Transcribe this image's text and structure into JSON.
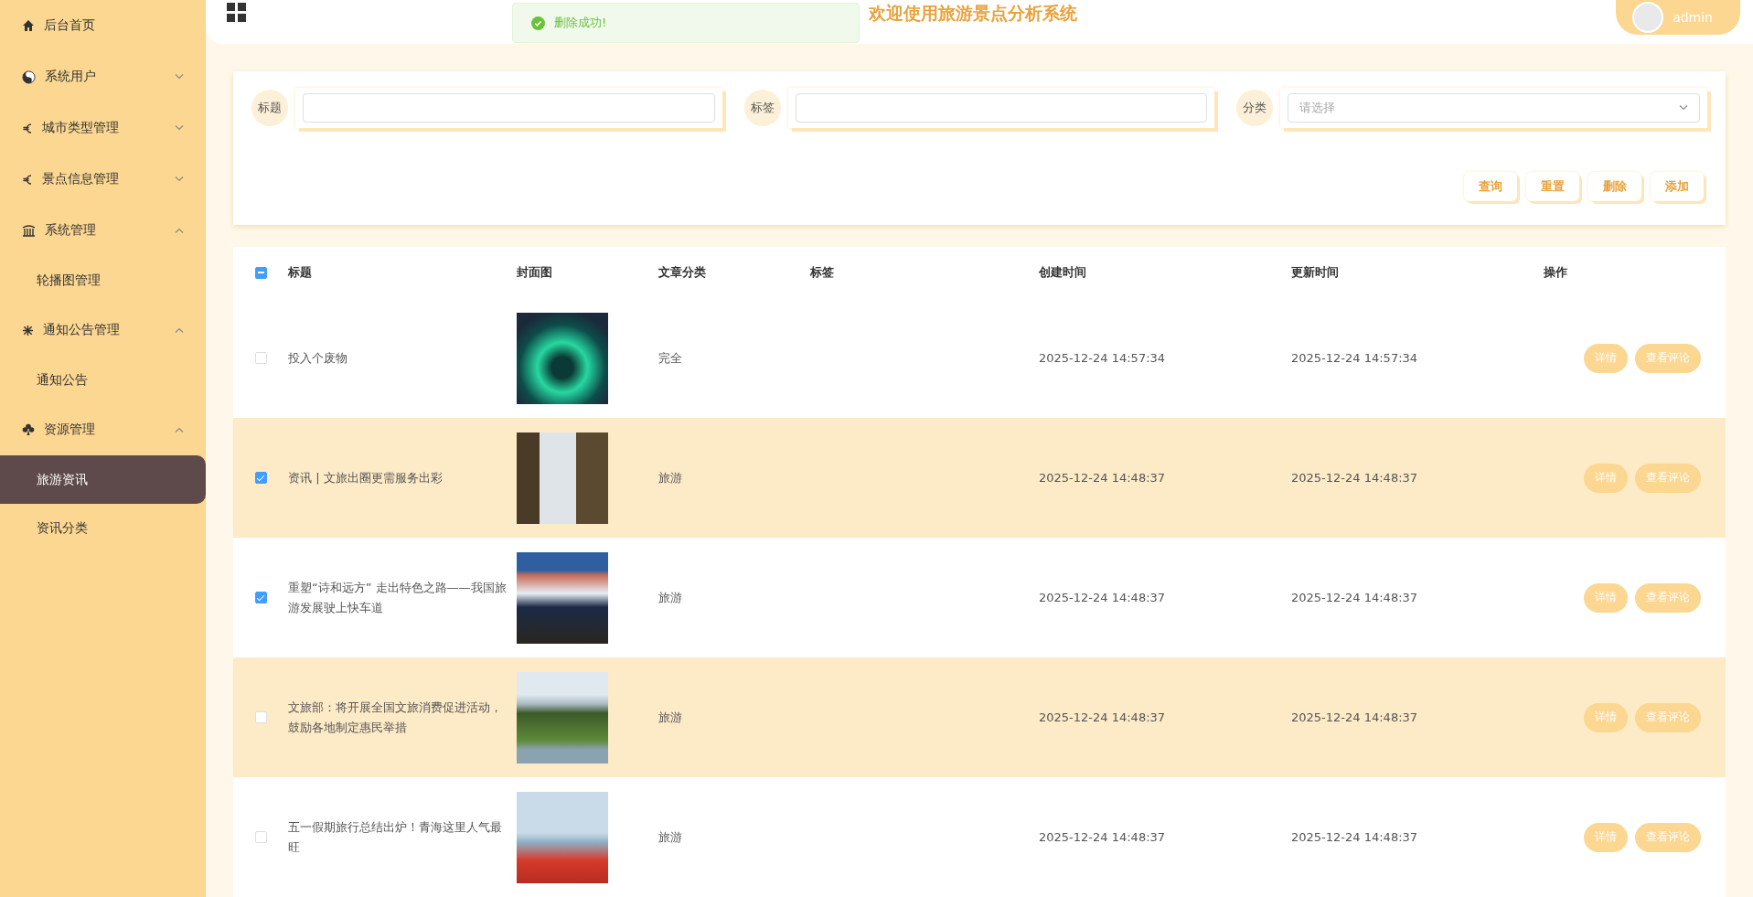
{
  "sidebar": {
    "items": [
      {
        "label": "后台首页",
        "kind": "link"
      },
      {
        "label": "系统用户",
        "kind": "group",
        "expanded": false
      },
      {
        "label": "城市类型管理",
        "kind": "group",
        "expanded": false
      },
      {
        "label": "景点信息管理",
        "kind": "group",
        "expanded": false
      },
      {
        "label": "系统管理",
        "kind": "group",
        "expanded": true,
        "children": [
          {
            "label": "轮播图管理",
            "selected": false
          }
        ]
      },
      {
        "label": "通知公告管理",
        "kind": "group",
        "expanded": true,
        "children": [
          {
            "label": "通知公告",
            "selected": false
          }
        ]
      },
      {
        "label": "资源管理",
        "kind": "group",
        "expanded": true,
        "children": [
          {
            "label": "旅游资讯",
            "selected": true
          },
          {
            "label": "资讯分类",
            "selected": false
          }
        ]
      }
    ]
  },
  "header": {
    "title": "欢迎使用旅游景点分析系统",
    "user": "admin"
  },
  "toast": {
    "message": "删除成功!"
  },
  "search": {
    "fields": [
      {
        "label": "标题",
        "kind": "text"
      },
      {
        "label": "标签",
        "kind": "text"
      },
      {
        "label": "分类",
        "kind": "select",
        "placeholder": "请选择"
      }
    ],
    "buttons": [
      "查询",
      "重置",
      "删除",
      "添加"
    ]
  },
  "table": {
    "select_all": {
      "indeterminate": true
    },
    "columns": [
      "标题",
      "封面图",
      "文章分类",
      "标签",
      "创建时间",
      "更新时间",
      "操作"
    ],
    "rows": [
      {
        "checked": false,
        "title": "投入个废物",
        "category": "完全",
        "created": "2025-12-24 14:57:34",
        "updated": "2025-12-24 14:57:34",
        "actions": [
          "详情",
          "查看评论"
        ]
      },
      {
        "checked": true,
        "title": "资讯 | 文旅出圈更需服务出彩",
        "category": "旅游",
        "created": "2025-12-24 14:48:37",
        "updated": "2025-12-24 14:48:37",
        "actions": [
          "详情",
          "查看评论"
        ]
      },
      {
        "checked": true,
        "title": "重塑“诗和远方” 走出特色之路——我国旅游发展驶上快车道",
        "category": "旅游",
        "created": "2025-12-24 14:48:37",
        "updated": "2025-12-24 14:48:37",
        "actions": [
          "详情",
          "查看评论"
        ]
      },
      {
        "checked": false,
        "title": "文旅部：将开展全国文旅消费促进活动，鼓励各地制定惠民举措",
        "category": "旅游",
        "created": "2025-12-24 14:48:37",
        "updated": "2025-12-24 14:48:37",
        "actions": [
          "详情",
          "查看评论"
        ]
      },
      {
        "checked": false,
        "title": "五一假期旅行总结出炉！青海这里人气最旺",
        "category": "旅游",
        "created": "2025-12-24 14:48:37",
        "updated": "2025-12-24 14:48:37",
        "actions": [
          "详情",
          "查看评论"
        ]
      }
    ]
  }
}
